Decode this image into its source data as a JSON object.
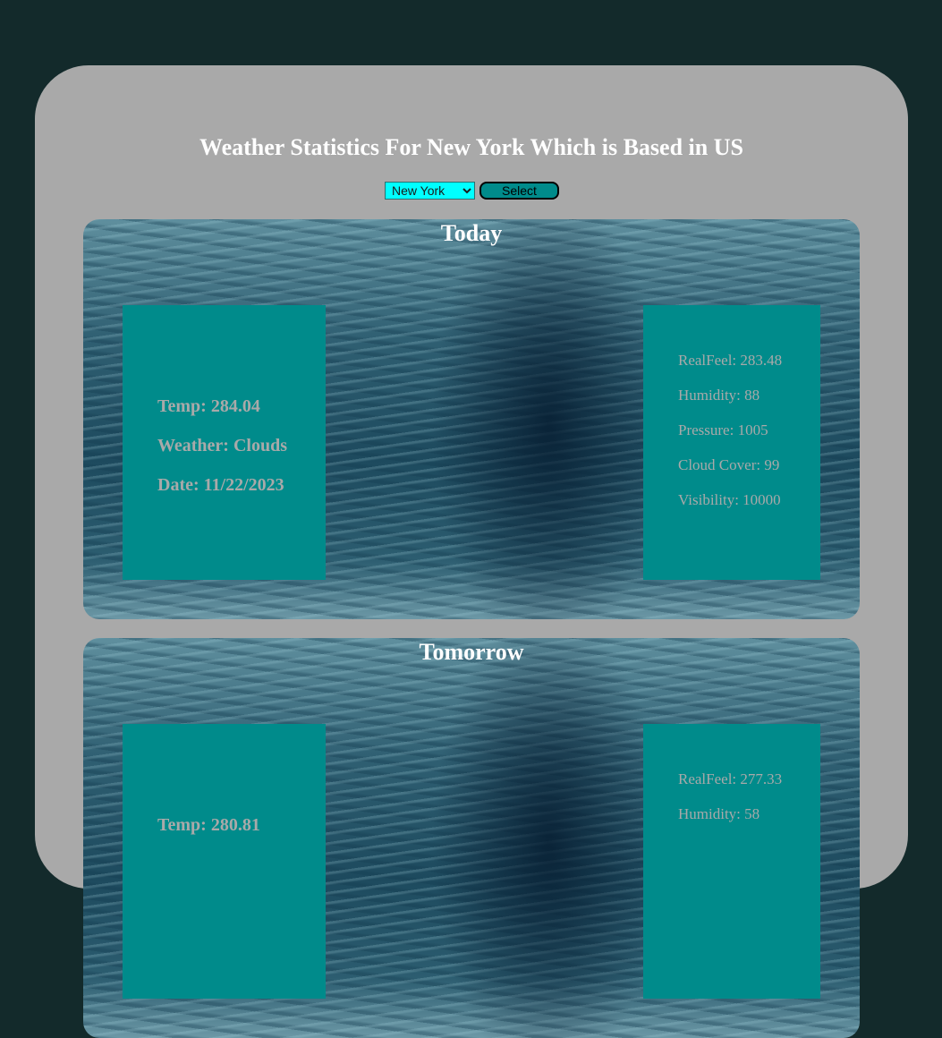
{
  "colors": {
    "background": "#132a2b",
    "panel": "#a9a9a9",
    "box": "#008b8b",
    "select_bg": "#00ffff",
    "title_text": "#ffffff",
    "box_text": "#a9a9a9"
  },
  "header": {
    "title": "Weather Statistics For New York Which is Based in US"
  },
  "controls": {
    "city_selected": "New York",
    "select_label": "Select"
  },
  "cards": [
    {
      "title": "Today",
      "temp": "Temp: 284.04",
      "weather": "Weather: Clouds",
      "date": "Date: 11/22/2023",
      "realfeel": "RealFeel: 283.48",
      "humidity": "Humidity: 88",
      "pressure": "Pressure: 1005",
      "cloud_cover": "Cloud Cover: 99",
      "visibility": "Visibility: 10000"
    },
    {
      "title": "Tomorrow",
      "temp": "Temp: 280.81",
      "realfeel": "RealFeel: 277.33",
      "humidity": "Humidity: 58"
    }
  ]
}
